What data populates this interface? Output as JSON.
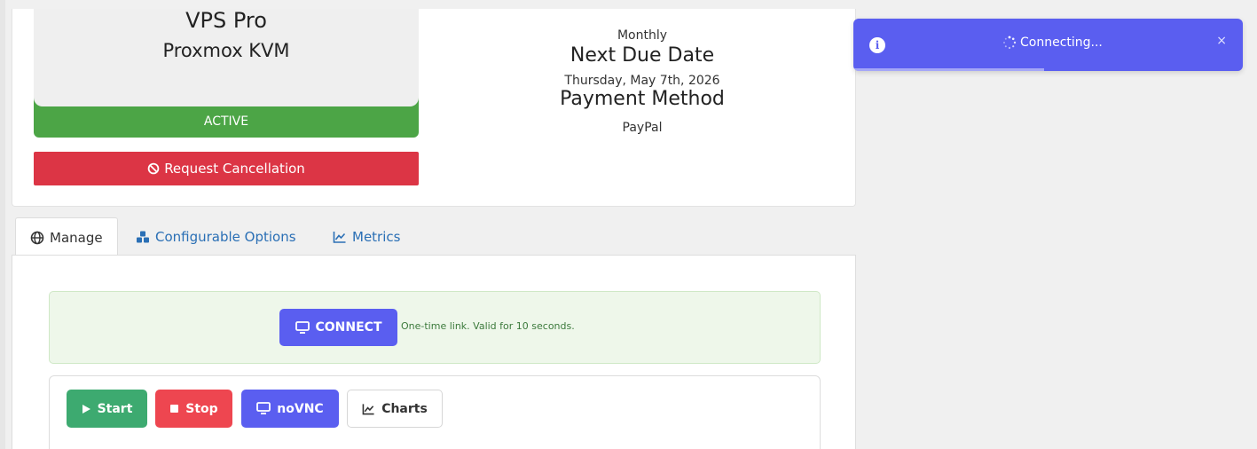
{
  "product": {
    "name": "VPS Pro",
    "group": "Proxmox KVM",
    "status": "ACTIVE",
    "cancel_label": "Request Cancellation"
  },
  "billing": {
    "cycle": "Monthly",
    "due_title": "Next Due Date",
    "due_date": "Thursday, May 7th, 2026",
    "payment_title": "Payment Method",
    "payment_value": "PayPal"
  },
  "tabs": [
    {
      "label": "Manage",
      "icon": "globe-icon",
      "active": true
    },
    {
      "label": "Configurable Options",
      "icon": "cubes-icon",
      "active": false
    },
    {
      "label": "Metrics",
      "icon": "line-chart-icon",
      "active": false
    }
  ],
  "connect": {
    "button_label": "CONNECT",
    "note": "One-time link. Valid for 10 seconds."
  },
  "actions": {
    "start": "Start",
    "stop": "Stop",
    "novnc": "noVNC",
    "charts": "Charts"
  },
  "toast": {
    "message": "Connecting...",
    "info_glyph": "i",
    "close_glyph": "×",
    "progress": 0.49
  },
  "colors": {
    "active_green": "#4ca546",
    "danger_red": "#dc3545",
    "accent_indigo": "#5a5ef0",
    "start_green": "#3daa70",
    "stop_red": "#ee4650"
  }
}
